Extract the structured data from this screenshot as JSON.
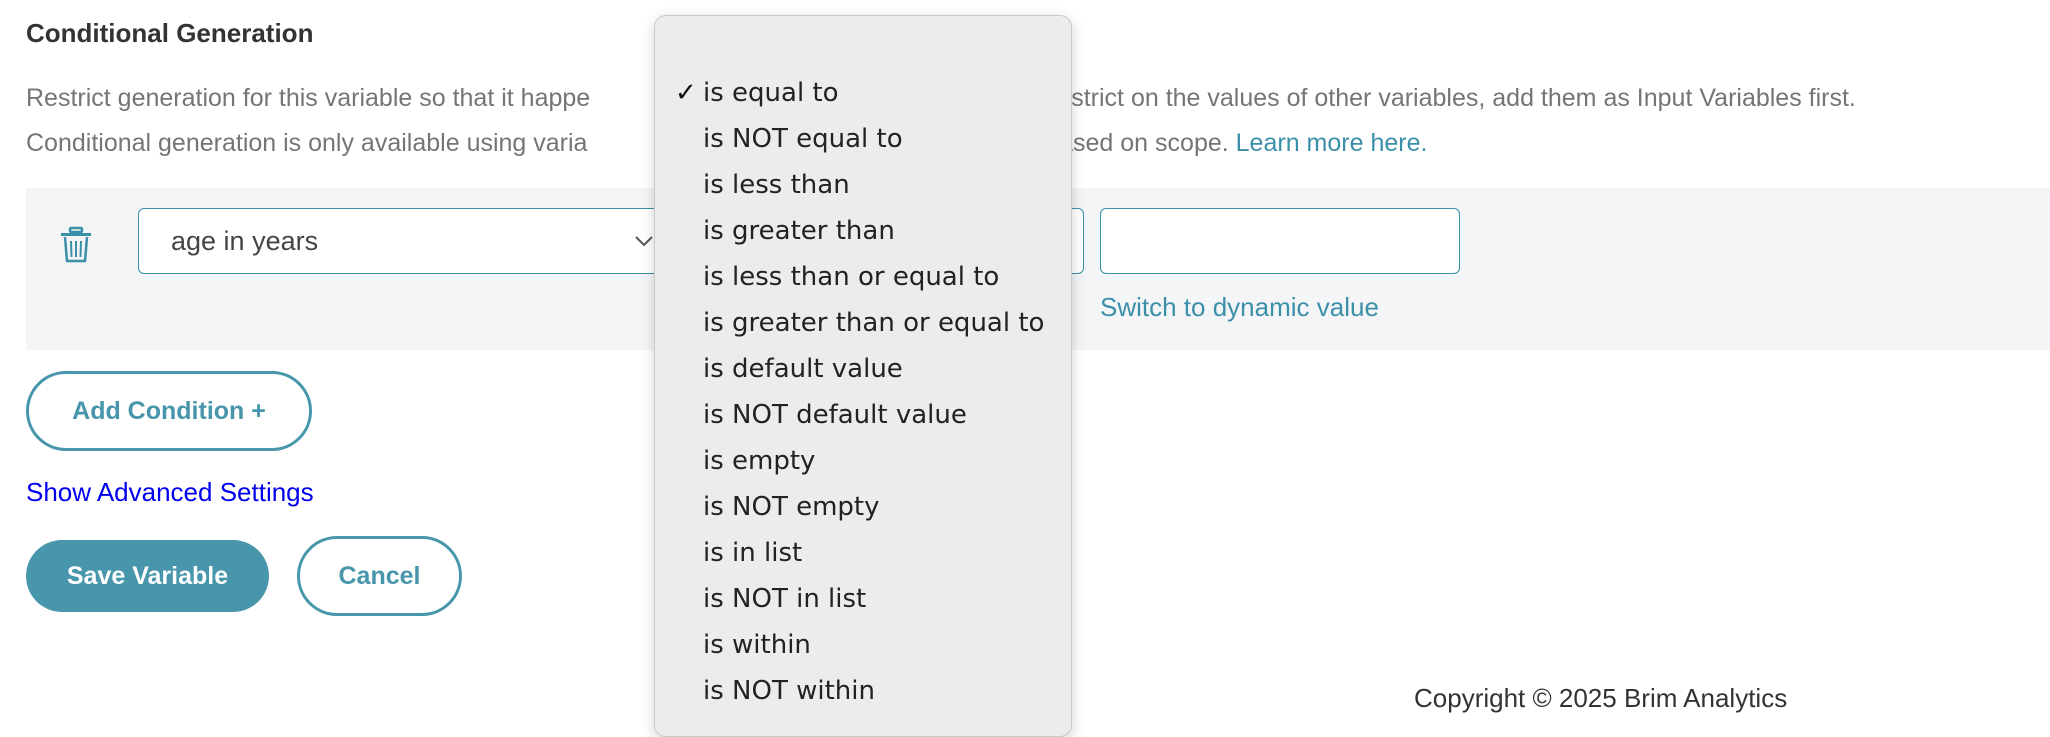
{
  "section": {
    "title": "Conditional Generation",
    "desc_line1_start": "Restrict generation for this variable so that it happe",
    "desc_line1_end": ". To restrict on the values of other variables, add them as Input Variables first.",
    "desc_line2_start": "Conditional generation is only available using varia",
    "desc_line2_end": "ue based on scope.",
    "learn_more": "Learn more here."
  },
  "condition": {
    "variable_value": "age in years",
    "operator_selected": "is equal to",
    "value_input": "",
    "switch_dynamic": "Switch to dynamic value"
  },
  "buttons": {
    "add_condition": "Add Condition +",
    "show_advanced": "Show Advanced Settings",
    "save": "Save Variable",
    "cancel": "Cancel"
  },
  "dropdown": {
    "check": "✓",
    "options": [
      "is equal to",
      "is NOT equal to",
      "is less than",
      "is greater than",
      "is less than or equal to",
      "is greater than or equal to",
      "is default value",
      "is NOT default value",
      "is empty",
      "is NOT empty",
      "is in list",
      "is NOT in list",
      "is within",
      "is NOT within"
    ]
  },
  "footer": {
    "copyright": "Copyright © 2025 Brim Analytics"
  },
  "colors": {
    "accent": "#4796ab",
    "link": "#3b8fa8",
    "advanced_link": "#0000ee"
  },
  "icons": [
    "trash-icon",
    "chevron-down-icon",
    "checkmark-icon"
  ]
}
